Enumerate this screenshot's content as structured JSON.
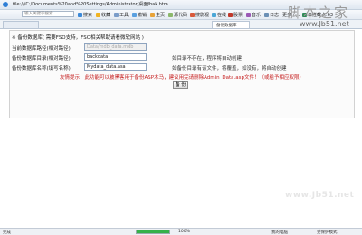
{
  "window": {
    "address": "file:///C:/Documents%20and%20Settings/Administrator/桌面/bak.htm"
  },
  "toolbar": {
    "search_placeholder": "输入关键字搜索",
    "items": [
      "搜索",
      "收藏",
      "工具",
      "撤销",
      "主页",
      "源代码",
      "搜影视",
      "在线",
      "股票",
      "音乐",
      "日志",
      "更多",
      "日拦截点:63"
    ]
  },
  "tabs": [
    "备份数据库",
    "新建标签"
  ],
  "watermark": {
    "top_chars": "脚本之家",
    "top_url": "www.Jb51.net",
    "bottom_url": "www.Jb51.net"
  },
  "form": {
    "heading": "※ 备份数据库( 需要FSO支持，FSO相关帮助请看微软网站 )",
    "rows": [
      {
        "label": "当前数据库路径(相对路径):",
        "value": "Data/mdb_data.mdb",
        "hint": ""
      },
      {
        "label": "备份数据库目录(相对路径):",
        "value": "backdata",
        "hint": "如目录不存在，程序将自动创建"
      },
      {
        "label": "备份数据库名称(填写名称):",
        "value": "Mydata_data.asa",
        "hint": "如备份目录有该文件，将覆盖，如没有，将自动创建"
      }
    ],
    "warning": "友情提示：此功能可以被黑客用于备份ASP木马，建议用完请删除Admin_Data.asp文件！（或给予相应权限）",
    "button": "备 份"
  },
  "statusbar": {
    "left": "完成",
    "progress_percent": 100,
    "zoom": "100%",
    "items": [
      "我的电脑",
      "受保护模式"
    ]
  }
}
